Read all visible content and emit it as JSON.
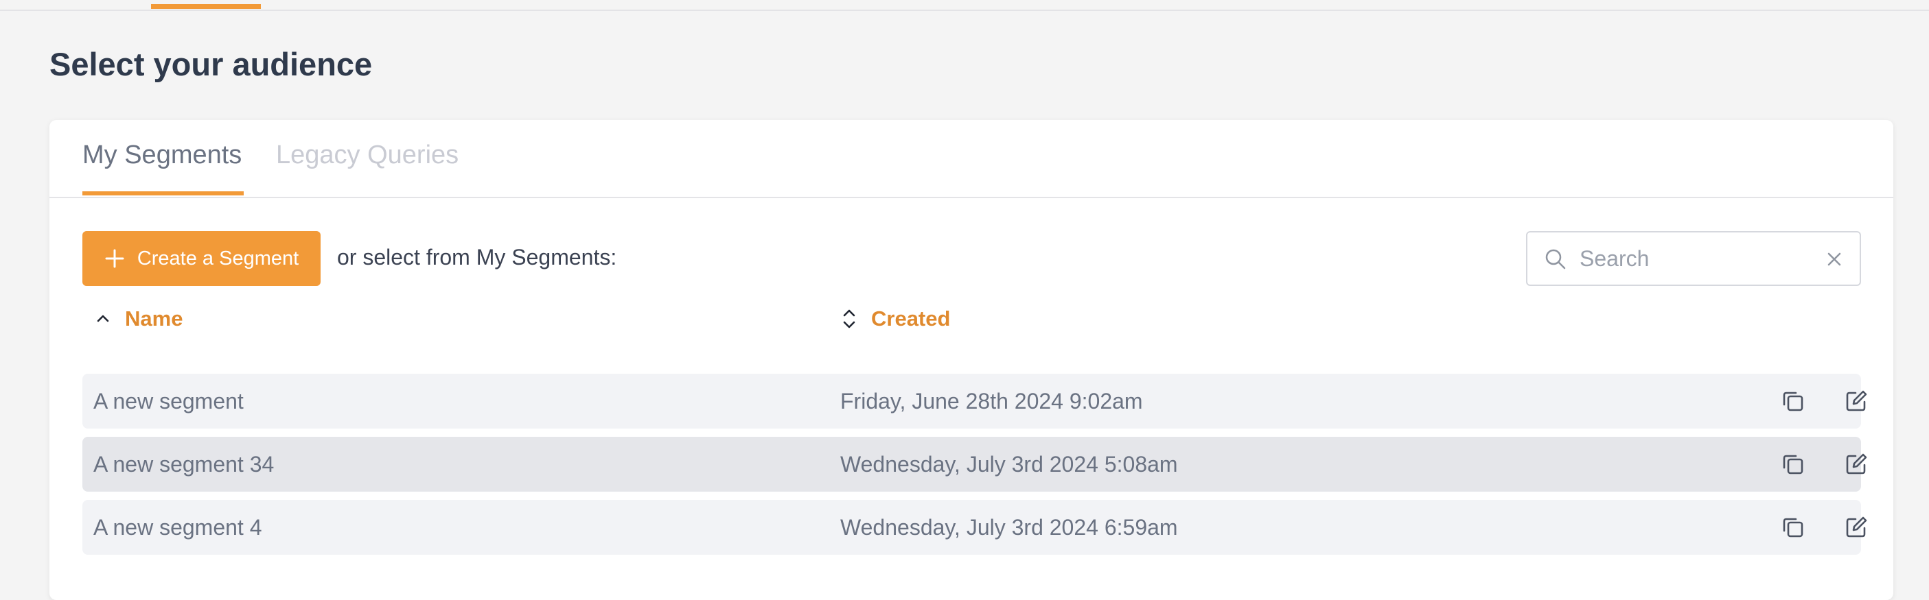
{
  "page": {
    "title": "Select your audience"
  },
  "tabs": [
    {
      "label": "My Segments",
      "active": true
    },
    {
      "label": "Legacy Queries",
      "active": false
    }
  ],
  "toolbar": {
    "create_label": "Create a Segment",
    "select_text": "or select from My Segments:",
    "search_placeholder": "Search",
    "search_value": ""
  },
  "table": {
    "columns": [
      {
        "label": "Name",
        "sort": "ascending",
        "icon": "chevron-up-icon"
      },
      {
        "label": "Created",
        "sort": "none",
        "icon": "sort-icon"
      }
    ],
    "rows": [
      {
        "name": "A new segment",
        "created": "Friday, June 28th 2024 9:02am"
      },
      {
        "name": "A new segment 34",
        "created": "Wednesday, July 3rd 2024 5:08am"
      },
      {
        "name": "A new segment 4",
        "created": "Wednesday, July 3rd 2024 6:59am"
      }
    ],
    "row_actions": [
      "copy-icon",
      "edit-icon"
    ]
  },
  "colors": {
    "accent": "#f29a38",
    "header_text": "#e08a2e",
    "title": "#2f3a4c",
    "row_bg": "#f2f3f6",
    "row_hover_bg": "#e5e6ea"
  }
}
